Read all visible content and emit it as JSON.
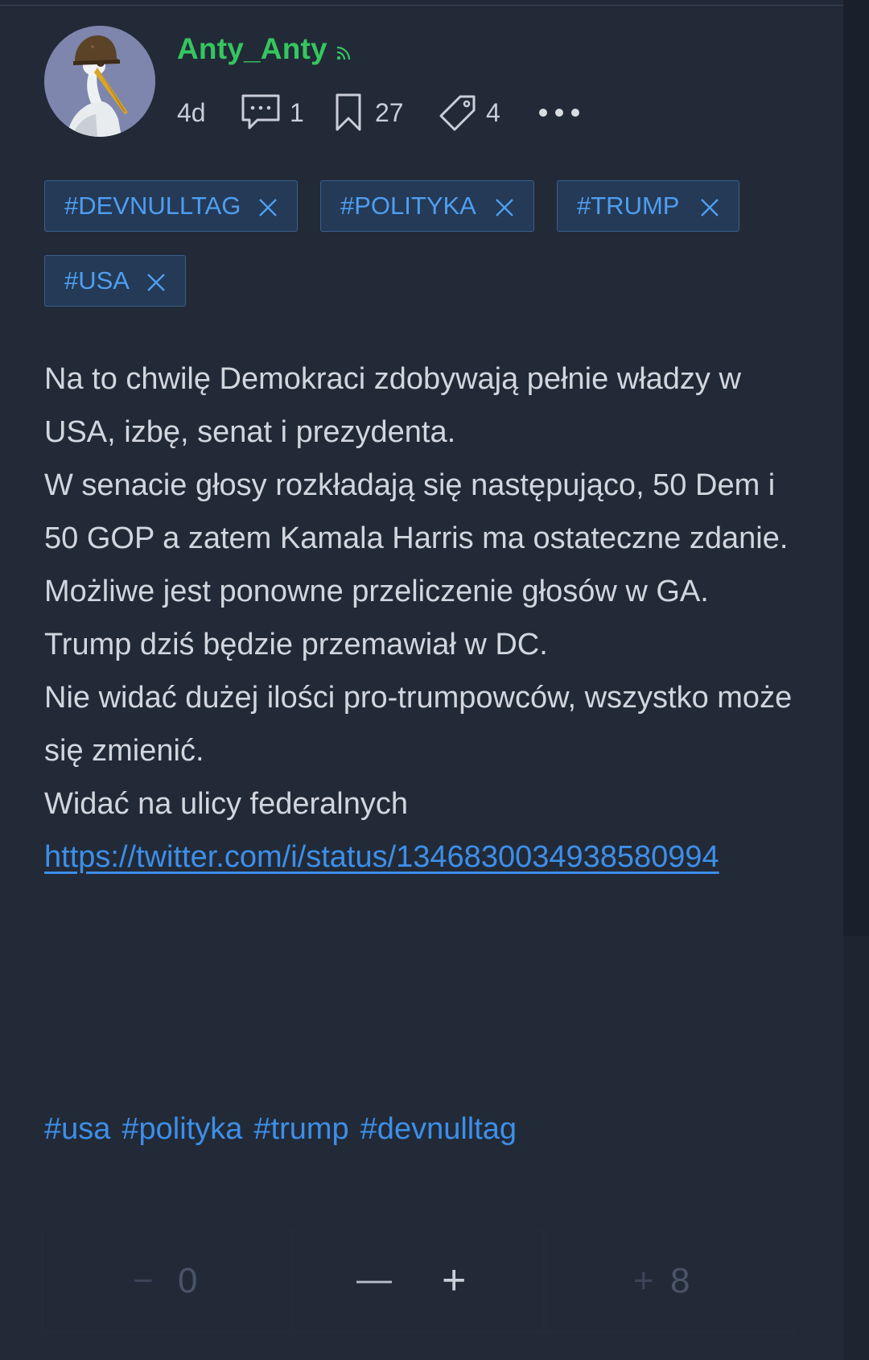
{
  "post": {
    "author": "Anty_Anty",
    "age": "4d",
    "comments_count": "1",
    "bookmarks_count": "27",
    "tags_count": "4",
    "more_label": "•••"
  },
  "tags": [
    {
      "label": "#DEVNULLTAG"
    },
    {
      "label": "#POLITYKA"
    },
    {
      "label": "#TRUMP"
    },
    {
      "label": "#USA"
    }
  ],
  "content": {
    "paragraph_1": "Na to chwilę Demokraci zdobywają pełnie władzy w USA, izbę, senat i prezydenta.",
    "paragraph_2": "W senacie głosy rozkładają się następująco, 50 Dem i 50 GOP a zatem Kamala Harris ma ostateczne zdanie.",
    "paragraph_3": "Możliwe jest ponowne przeliczenie głosów w GA.",
    "paragraph_4": "Trump dziś będzie przemawiał w DC.",
    "paragraph_5": "Nie widać dużej ilości pro-trumpowców, wszystko może się zmienić.",
    "paragraph_6": "Widać na ulicy federalnych",
    "link": "https://twitter.com/i/status/1346830034938580994"
  },
  "hashtags": [
    "#usa",
    "#polityka",
    "#trump",
    "#devnulltag"
  ],
  "votes": {
    "minus_total": "0",
    "minus_sign": "−",
    "plus_total": "8",
    "plus_sign": "+",
    "downvote_symbol": "—",
    "upvote_symbol": "+"
  },
  "colors": {
    "background": "#222a38",
    "author": "#35c65e",
    "tag_text": "#4f9ef0",
    "tag_bg": "#243a57",
    "link": "#3d8fe8",
    "body_text": "#d2d6de"
  },
  "icons": [
    "rss-icon",
    "comment-icon",
    "bookmark-icon",
    "tag-icon",
    "more-icon",
    "close-icon",
    "avatar-heron-helmet"
  ]
}
